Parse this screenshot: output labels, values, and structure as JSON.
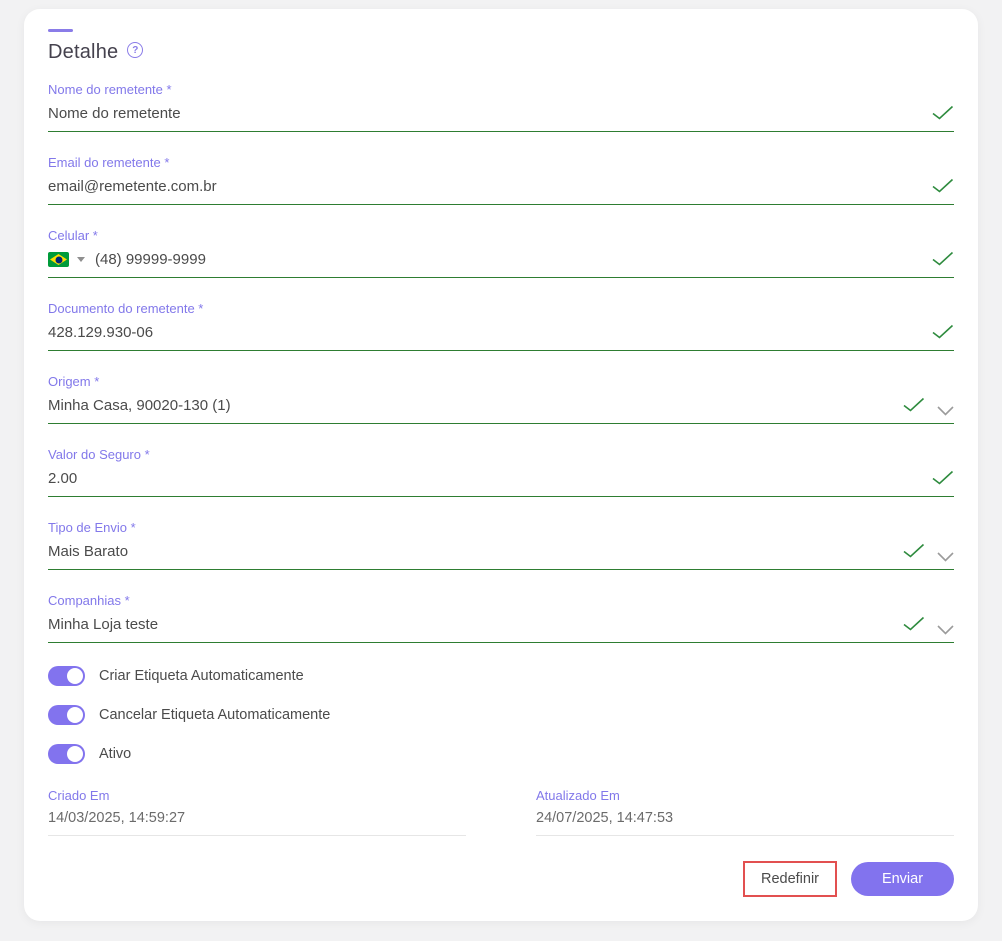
{
  "header": {
    "title": "Detalhe",
    "help_icon": "?"
  },
  "fields": [
    {
      "label": "Nome do remetente *",
      "value": "Nome do remetente",
      "type": "text",
      "valid": true
    },
    {
      "label": "Email do remetente *",
      "value": "email@remetente.com.br",
      "type": "text",
      "valid": true
    },
    {
      "label": "Celular *",
      "value": "(48) 99999-9999",
      "type": "phone",
      "country_flag": "brazil",
      "valid": true
    },
    {
      "label": "Documento do remetente *",
      "value": "428.129.930-06",
      "type": "text",
      "valid": true
    },
    {
      "label": "Origem *",
      "value": "Minha Casa, 90020-130 (1)",
      "type": "select",
      "valid": true
    },
    {
      "label": "Valor do Seguro *",
      "value": "2.00",
      "type": "text",
      "valid": true
    },
    {
      "label": "Tipo de Envio *",
      "value": "Mais Barato",
      "type": "select",
      "valid": true
    },
    {
      "label": "Companhias *",
      "value": "Minha Loja teste",
      "type": "select",
      "valid": true
    }
  ],
  "toggles": [
    {
      "label": "Criar Etiqueta Automaticamente",
      "state": "on"
    },
    {
      "label": "Cancelar Etiqueta Automaticamente",
      "state": "on"
    },
    {
      "label": "Ativo",
      "state": "on"
    }
  ],
  "timestamps": [
    {
      "label": "Criado Em",
      "value": "14/03/2025, 14:59:27"
    },
    {
      "label": "Atualizado Em",
      "value": "24/07/2025, 14:47:53"
    }
  ],
  "actions": {
    "reset_label": "Redefinir",
    "submit_label": "Enviar"
  },
  "colors": {
    "primary_purple": "#8273ee",
    "label_purple": "#8278ea",
    "success_green": "#2e7d32",
    "text_dark": "#4b4b4b",
    "annotation_red": "#e25050",
    "page_background": "#f2f2f3"
  }
}
